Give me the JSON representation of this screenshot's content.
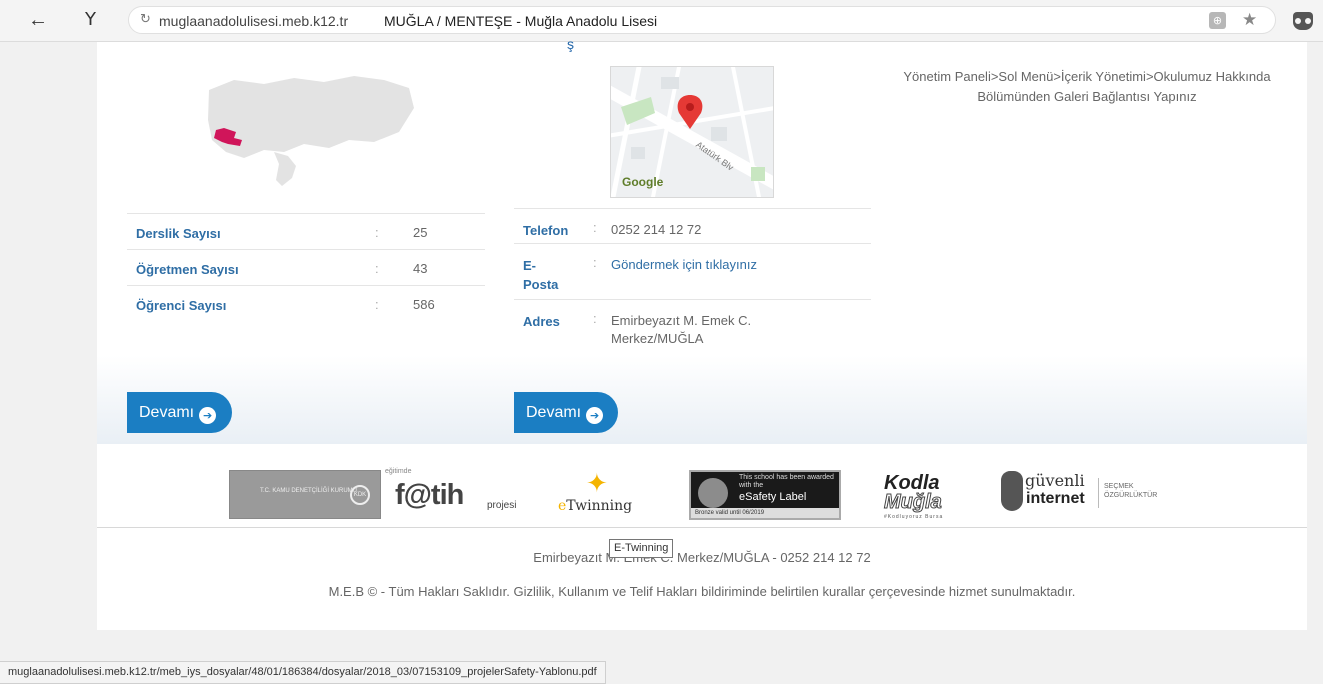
{
  "browser": {
    "url": "muglaanadolulisesi.meb.k12.tr",
    "title": "MUĞLA / MENTEŞE - Muğla Anadolu Lisesi",
    "logo": "Y",
    "icons": {
      "back": "back-arrow-icon",
      "reload": "reload-icon",
      "extension": "extension-icon",
      "bookmark": "star-icon",
      "profile": "profile-icon"
    }
  },
  "stats": [
    {
      "label": "Derslik Sayısı",
      "sep": ":",
      "value": "25"
    },
    {
      "label": "Öğretmen Sayısı",
      "sep": ":",
      "value": "43"
    },
    {
      "label": "Öğrenci Sayısı",
      "sep": ":",
      "value": "586"
    }
  ],
  "map": {
    "google": "Google",
    "road": "Atatürk Blv",
    "pin": "M"
  },
  "contact": {
    "phone_label": "Telefon",
    "phone": "0252 214 12 72",
    "email_label": "E-Posta",
    "email": "Göndermek için tıklayınız",
    "address_label": "Adres",
    "address": "Emirbeyazıt M. Emek C. Merkez/MUĞLA",
    "sep": ":"
  },
  "gallery_note": "Yönetim Paneli>Sol Menü>İçerik Yönetimi>Okulumuz Hakkında Bölümünden Galeri Bağlantısı Yapınız",
  "buttons": {
    "more_1": "Devamı",
    "more_2": "Devamı",
    "arrow": "➔"
  },
  "logos": {
    "kdk": {
      "text": "T.C. KAMU DENETÇİLİĞİ KURUMU",
      "badge": "KDK"
    },
    "fatih": {
      "top": "eğitimde",
      "main": "f@tih",
      "sub": "projesi"
    },
    "etwinning": {
      "star": "✦",
      "prefix": "e",
      "text": "Twinning"
    },
    "esafety": {
      "line1": "This school has been awarded with the",
      "line2": "eSafety Label",
      "bottom": "Bronze   valid until 06/2019"
    },
    "kodla": {
      "line1": "Kodla",
      "line2": "Muğla",
      "line3": "#Kodluyoruz Bursa"
    },
    "guvenli": {
      "line1": "güvenli",
      "line2": "internet",
      "line3": "SEÇMEK ÖZGÜRLÜKTÜR"
    }
  },
  "tooltip": "E-Twinning",
  "footer": {
    "address": "Emirbeyazıt M. Emek C. Merkez/MUĞLA - 0252 214 12 72",
    "copyright": "M.E.B © - Tüm Hakları Saklıdır. Gizlilik, Kullanım ve Telif Hakları bildiriminde belirtilen kurallar çerçevesinde hizmet sunulmaktadır."
  },
  "status_url": "muglaanadolulisesi.meb.k12.tr/meb_iys_dosyalar/48/01/186384/dosyalar/2018_03/07153109_projelerSafety-Yablonu.pdf",
  "colors": {
    "accent": "#1b7ec3",
    "label_blue": "#2f6ea5",
    "highlight_region": "#d0155a"
  }
}
